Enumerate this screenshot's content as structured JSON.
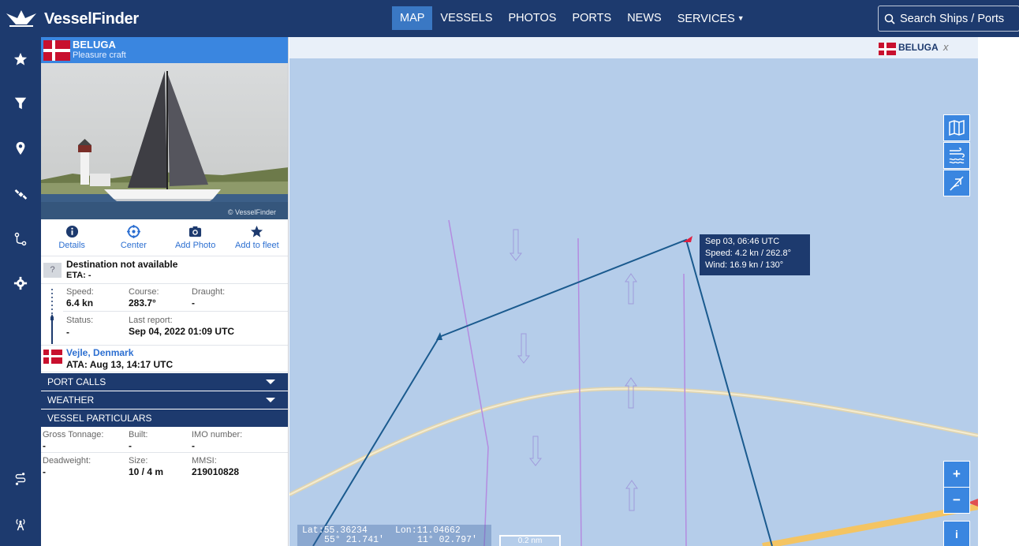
{
  "app": {
    "name": "VesselFinder",
    "logo_icon": "ship-logo-icon"
  },
  "nav": {
    "items": [
      {
        "label": "MAP",
        "active": true
      },
      {
        "label": "VESSELS",
        "active": false
      },
      {
        "label": "PHOTOS",
        "active": false
      },
      {
        "label": "PORTS",
        "active": false
      },
      {
        "label": "NEWS",
        "active": false
      },
      {
        "label": "SERVICES",
        "active": false
      }
    ]
  },
  "search": {
    "placeholder": "Search Ships / Ports"
  },
  "rail": {
    "icons": [
      "star-icon",
      "filter-icon",
      "location-pin-icon",
      "satellite-icon",
      "route-icon",
      "gear-icon",
      "voyage-icon",
      "antenna-icon"
    ]
  },
  "vessel": {
    "name": "BELUGA",
    "type": "Pleasure craft",
    "flag_colors": {
      "red": "#c8102e",
      "white": "#ffffff"
    },
    "photo_watermark": "© VesselFinder",
    "actions": [
      {
        "label": "Details",
        "icon": "info-icon"
      },
      {
        "label": "Center",
        "icon": "crosshair-icon"
      },
      {
        "label": "Add Photo",
        "icon": "camera-icon"
      },
      {
        "label": "Add to fleet",
        "icon": "star-icon"
      }
    ],
    "destination": {
      "badge": "?",
      "title": "Destination not available",
      "eta": "ETA: -"
    },
    "speed": {
      "label": "Speed:",
      "value": "6.4 kn"
    },
    "course": {
      "label": "Course:",
      "value": "283.7°"
    },
    "draught": {
      "label": "Draught:",
      "value": "-"
    },
    "status": {
      "label": "Status:",
      "value": "-"
    },
    "last_report": {
      "label": "Last report:",
      "value": "Sep 04, 2022 01:09 UTC"
    },
    "port": {
      "name": "Vejle, Denmark",
      "ata": "ATA: Aug 13, 14:17 UTC"
    },
    "sections": {
      "port_calls": "PORT CALLS",
      "weather": "WEATHER",
      "particulars": "VESSEL PARTICULARS"
    },
    "gross_tonnage": {
      "label": "Gross Tonnage:",
      "value": "-"
    },
    "built": {
      "label": "Built:",
      "value": "-"
    },
    "imo": {
      "label": "IMO number:",
      "value": "-"
    },
    "deadweight": {
      "label": "Deadweight:",
      "value": "-"
    },
    "size": {
      "label": "Size:",
      "value": "10 / 4 m"
    },
    "mmsi": {
      "label": "MMSI:",
      "value": "219010828"
    }
  },
  "map": {
    "tab_name": "BELUGA",
    "tab_close": "x",
    "tooltip": {
      "time": "Sep 03, 06:46 UTC",
      "speed": "Speed: 4.2 kn / 262.8°",
      "wind": "Wind: 16.9 kn / 130°"
    },
    "coords": {
      "lat_decimal": "Lat:55.36234",
      "lon_decimal": "Lon:11.04662",
      "lat_dms": "55° 21.741′",
      "lon_dms": "11° 02.797′"
    },
    "scale": "0.2 nm",
    "controls": [
      "map-layers-icon",
      "wind-waves-icon",
      "measure-icon"
    ],
    "zoom_in": "+",
    "zoom_out": "−",
    "info": "i",
    "colors": {
      "water": "#b5cdea",
      "track": "#1a5a8e",
      "lane": "#b48be0",
      "road": "#f4c462"
    }
  }
}
